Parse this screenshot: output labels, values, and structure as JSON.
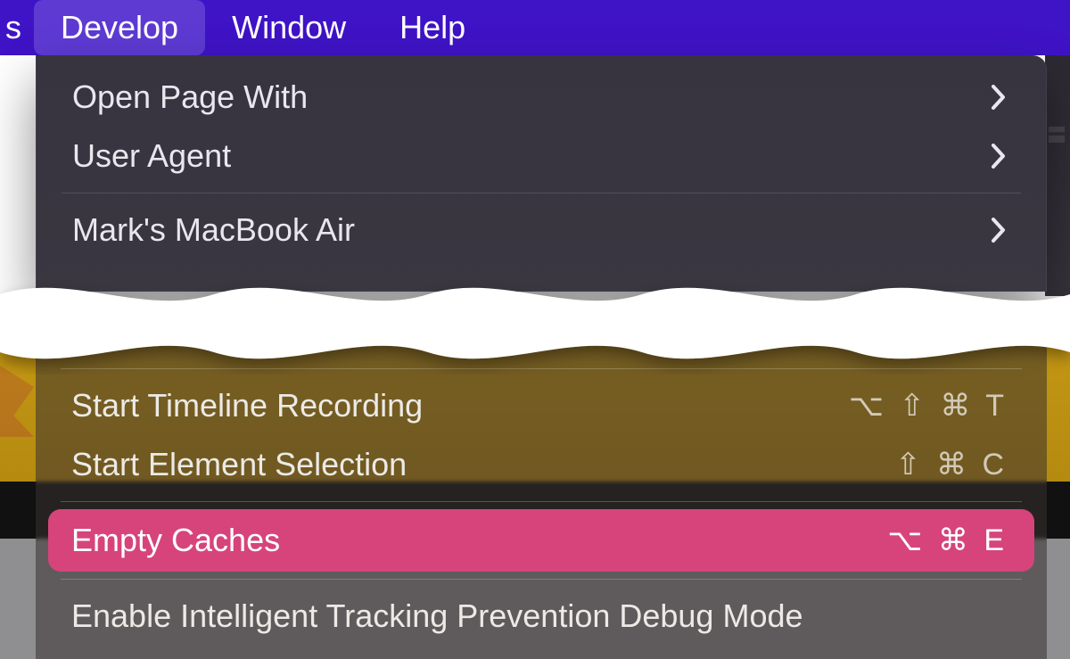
{
  "menubar": {
    "truncated_prev": "s",
    "items": [
      {
        "label": "Develop",
        "active": true
      },
      {
        "label": "Window",
        "active": false
      },
      {
        "label": "Help",
        "active": false
      }
    ]
  },
  "dropdown_upper": {
    "items": [
      {
        "label": "Open Page With",
        "submenu": true
      },
      {
        "label": "User Agent",
        "submenu": true
      }
    ],
    "items2": [
      {
        "label": "Mark's MacBook Air",
        "submenu": true
      }
    ]
  },
  "dropdown_lower": {
    "groupA": [
      {
        "label": "Start Timeline Recording",
        "shortcut": "⌥ ⇧ ⌘ T"
      },
      {
        "label": "Start Element Selection",
        "shortcut": "⇧ ⌘ C"
      }
    ],
    "selected": {
      "label": "Empty Caches",
      "shortcut": "⌥ ⌘ E"
    },
    "groupB": [
      {
        "label": "Enable Intelligent Tracking Prevention Debug Mode"
      }
    ]
  }
}
